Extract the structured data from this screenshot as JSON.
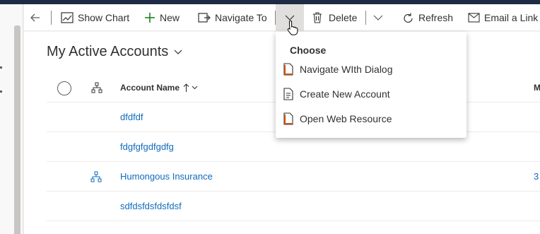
{
  "command_bar": {
    "items": [
      {
        "label": "Show Chart",
        "icon": "chart-icon"
      },
      {
        "label": "New",
        "icon": "plus-icon"
      },
      {
        "label": "Navigate To",
        "icon": "navigate-icon"
      },
      {
        "label": "Delete",
        "icon": "trash-icon"
      },
      {
        "label": "Refresh",
        "icon": "refresh-icon"
      },
      {
        "label": "Email a Link",
        "icon": "email-icon"
      }
    ]
  },
  "view": {
    "title": "My Active Accounts"
  },
  "grid": {
    "columns": [
      "Account Name",
      "M"
    ],
    "rows": [
      {
        "name": "dfdfdf",
        "hierarchy": false,
        "m": ""
      },
      {
        "name": "fdgfgfgdfgdfg",
        "hierarchy": false,
        "m": ""
      },
      {
        "name": "Humongous Insurance",
        "hierarchy": true,
        "m": "3"
      },
      {
        "name": "sdfdsfdsfdsfdsf",
        "hierarchy": false,
        "m": ""
      }
    ]
  },
  "flyout": {
    "heading": "Choose",
    "items": [
      {
        "label": "Navigate WIth Dialog",
        "icon": "web-resource-icon"
      },
      {
        "label": "Create New Account",
        "icon": "form-icon"
      },
      {
        "label": "Open Web Resource",
        "icon": "web-resource-icon"
      }
    ]
  },
  "colors": {
    "accent": "#0f6cbd",
    "green": "#107c10",
    "orange": "#ca5010"
  }
}
